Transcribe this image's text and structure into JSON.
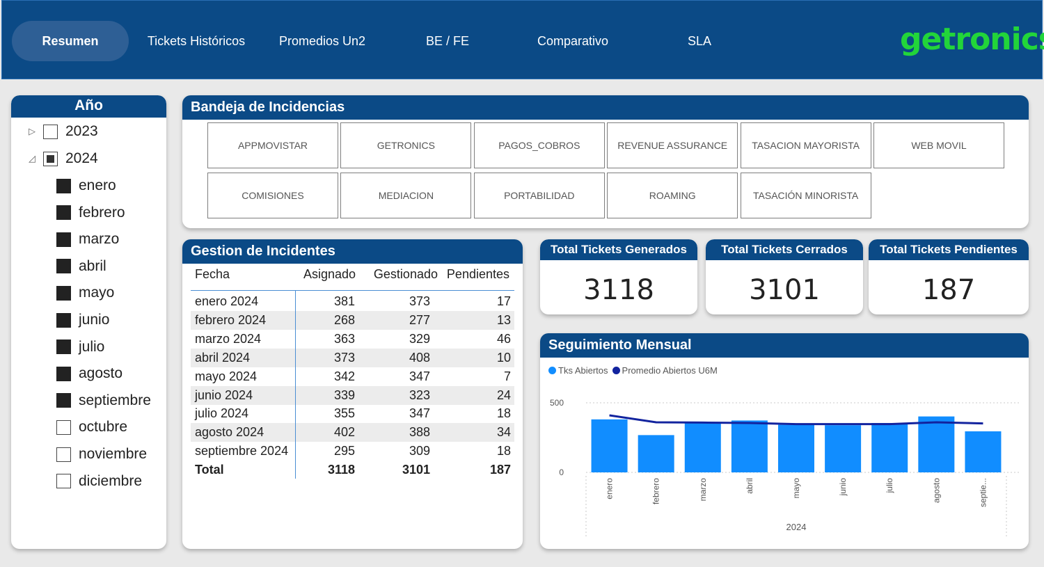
{
  "nav": {
    "tabs": [
      "Resumen",
      "Tickets Históricos",
      "Promedios Un2",
      "BE / FE",
      "Comparativo",
      "SLA"
    ],
    "active": "Resumen",
    "logo": "getronics"
  },
  "slicer": {
    "title": "Año",
    "years": [
      {
        "label": "2023",
        "state": "unchecked",
        "expanded": false
      },
      {
        "label": "2024",
        "state": "partial",
        "expanded": true
      }
    ],
    "months": [
      {
        "label": "enero",
        "checked": true
      },
      {
        "label": "febrero",
        "checked": true
      },
      {
        "label": "marzo",
        "checked": true
      },
      {
        "label": "abril",
        "checked": true
      },
      {
        "label": "mayo",
        "checked": true
      },
      {
        "label": "junio",
        "checked": true
      },
      {
        "label": "julio",
        "checked": true
      },
      {
        "label": "agosto",
        "checked": true
      },
      {
        "label": "septiembre",
        "checked": true
      },
      {
        "label": "octubre",
        "checked": false
      },
      {
        "label": "noviembre",
        "checked": false
      },
      {
        "label": "diciembre",
        "checked": false
      }
    ]
  },
  "bandeja": {
    "title": "Bandeja de Incidencias",
    "buttons": [
      "APPMOVISTAR",
      "GETRONICS",
      "PAGOS_COBROS",
      "REVENUE ASSURANCE",
      "TASACION MAYORISTA",
      "WEB MOVIL",
      "COMISIONES",
      "MEDIACION",
      "PORTABILIDAD",
      "ROAMING",
      "TASACIÓN MINORISTA"
    ]
  },
  "gestion": {
    "title": "Gestion de Incidentes",
    "columns": [
      "Fecha",
      "Asignado",
      "Gestionado",
      "Pendientes"
    ],
    "rows": [
      [
        "enero 2024",
        "381",
        "373",
        "17"
      ],
      [
        "febrero 2024",
        "268",
        "277",
        "13"
      ],
      [
        "marzo 2024",
        "363",
        "329",
        "46"
      ],
      [
        "abril 2024",
        "373",
        "408",
        "10"
      ],
      [
        "mayo 2024",
        "342",
        "347",
        "7"
      ],
      [
        "junio 2024",
        "339",
        "323",
        "24"
      ],
      [
        "julio 2024",
        "355",
        "347",
        "18"
      ],
      [
        "agosto 2024",
        "402",
        "388",
        "34"
      ],
      [
        "septiembre 2024",
        "295",
        "309",
        "18"
      ]
    ],
    "total": [
      "Total",
      "3118",
      "3101",
      "187"
    ]
  },
  "kpis": [
    {
      "title": "Total Tickets Generados",
      "value": "3118"
    },
    {
      "title": "Total Tickets Cerrados",
      "value": "3101"
    },
    {
      "title": "Total Tickets Pendientes",
      "value": "187"
    }
  ],
  "chart_data": {
    "type": "bar",
    "title": "Seguimiento Mensual",
    "categories": [
      "enero",
      "febrero",
      "marzo",
      "abril",
      "mayo",
      "junio",
      "julio",
      "agosto",
      "septie..."
    ],
    "series": [
      {
        "name": "Tks Abiertos",
        "type": "bar",
        "color": "#118dff",
        "values": [
          381,
          268,
          363,
          373,
          342,
          339,
          355,
          402,
          295
        ]
      },
      {
        "name": "Promedio Abiertos U6M",
        "type": "line",
        "color": "#12239e",
        "values": [
          410,
          360,
          358,
          355,
          347,
          347,
          347,
          360,
          352
        ]
      }
    ],
    "xlabel": "2024",
    "yticks": [
      "0",
      "500"
    ],
    "ylim": [
      0,
      500
    ],
    "legend_position": "top-left",
    "grid": true
  }
}
